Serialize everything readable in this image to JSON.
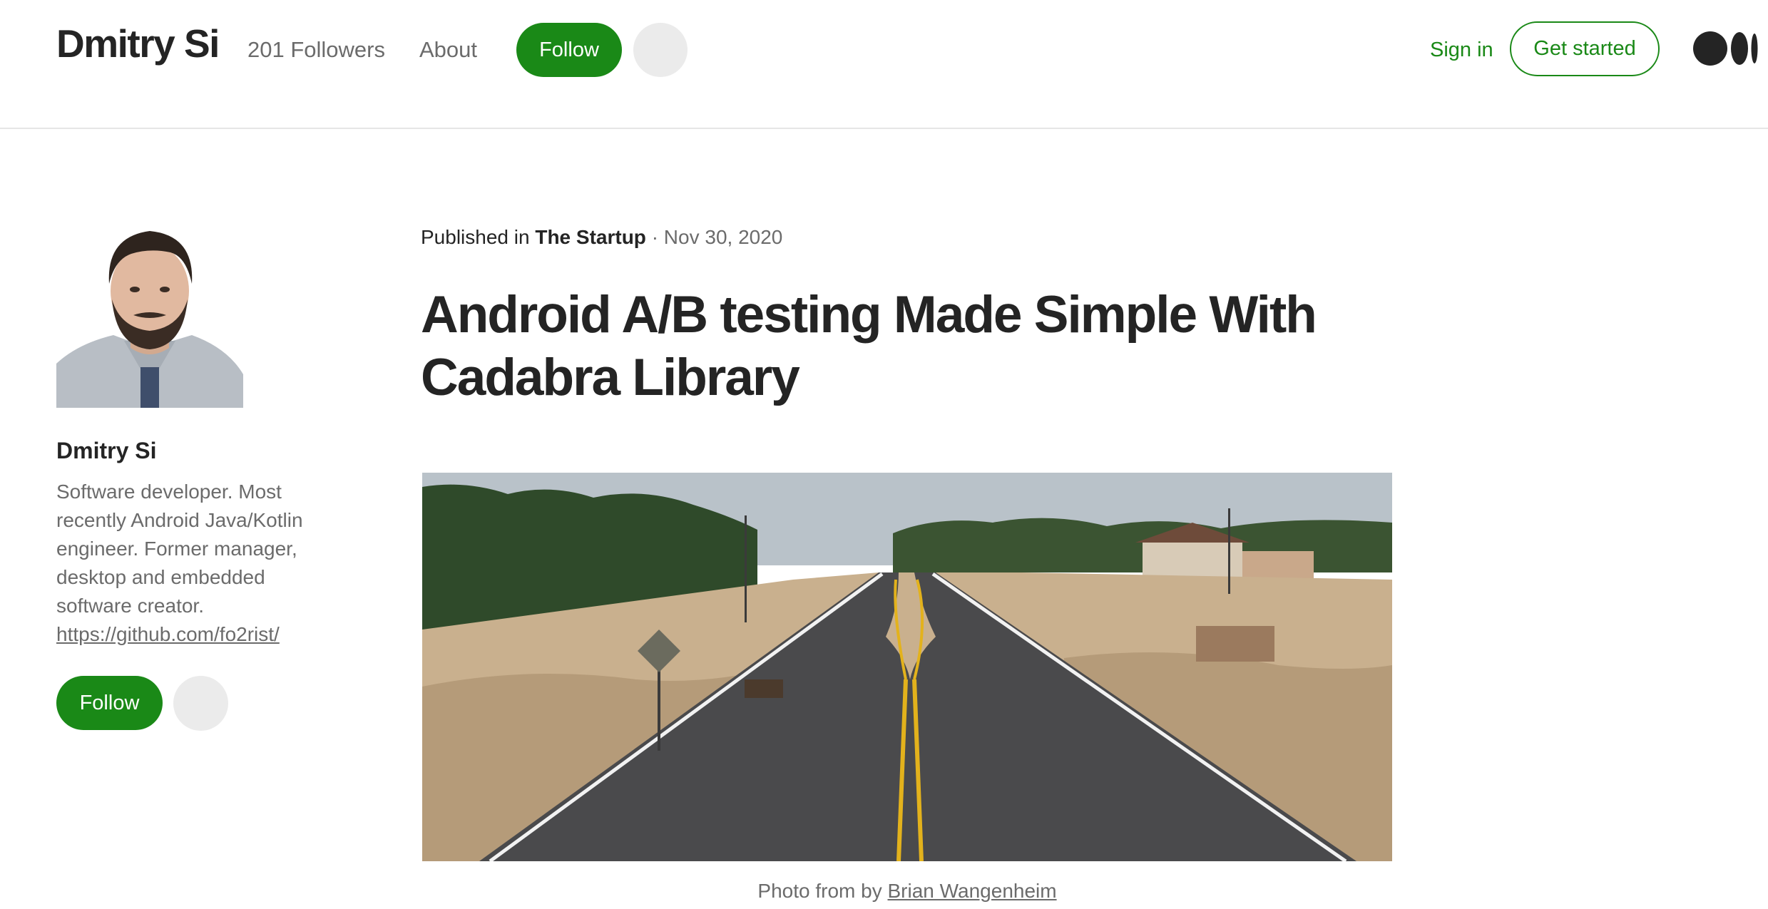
{
  "header": {
    "brand_name": "Dmitry Si",
    "followers": "201 Followers",
    "about": "About",
    "follow_label": "Follow",
    "sign_in": "Sign in",
    "get_started": "Get started",
    "logo_icon": "medium-logo-icon"
  },
  "author": {
    "photo_alt": "Dmitry Si",
    "name": "Dmitry Si",
    "bio": "Software developer. Most recently Android Java/Kotlin engineer. Former manager, desktop and embedded software creator.",
    "link": "https://github.com/fo2rist/",
    "follow_label": "Follow"
  },
  "article": {
    "published_in_prefix": "Published in",
    "publication": "The Startup",
    "separator": "·",
    "date": "Nov 30, 2020",
    "title": "Android A/B testing Made Simple With Cadabra Library",
    "caption_prefix": "Photo from by",
    "caption_author": "Brian Wangenheim"
  },
  "colors": {
    "accent_green": "#1a8917",
    "text_dark": "#242424",
    "text_grey": "#6b6b6b"
  }
}
